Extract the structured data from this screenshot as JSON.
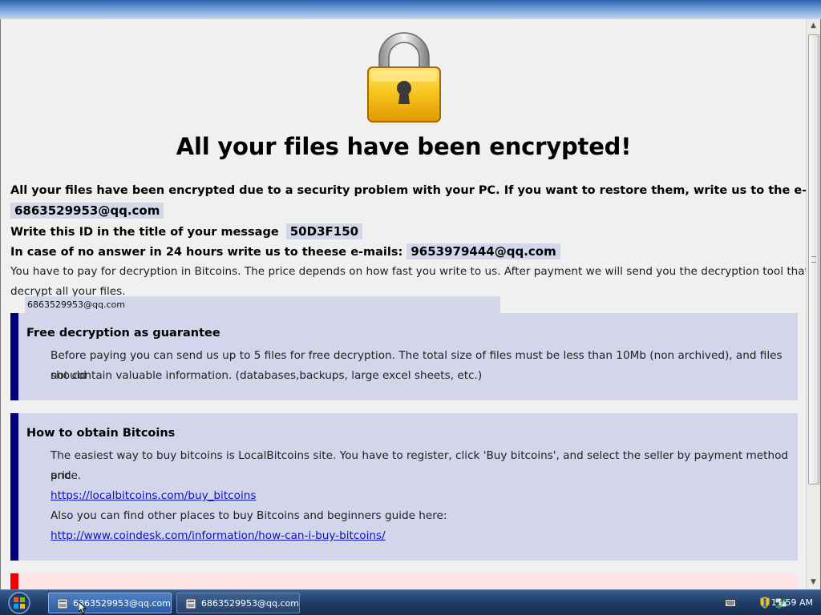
{
  "page": {
    "heading": "All your files have been encrypted!",
    "line1_text": "All your files have been encrypted due to a security problem with your PC. If you want to restore them, write us to the e-mail",
    "email1": "6863529953@qq.com",
    "line2_text": "Write this ID in the title of your message",
    "id": "50D3F150",
    "line3_text": "In case of no answer in 24 hours write us to theese e-mails:",
    "email2": "9653979444@qq.com",
    "payment_text_1": "You have to pay for decryption in Bitcoins. The price depends on how fast you write to us. After payment we will send you the decryption tool that will",
    "payment_text_2": "decrypt all your files.",
    "tooltip": "6863529953@qq.com"
  },
  "box_free": {
    "title": "Free decryption as guarantee",
    "text_1": "Before paying you can send us up to 5 files for free decryption. The total size of files must be less than 10Mb (non archived), and files should",
    "text_2": "not contain valuable information. (databases,backups, large excel sheets, etc.)"
  },
  "box_bitcoins": {
    "title": "How to obtain Bitcoins",
    "text_1": "The easiest way to buy bitcoins is LocalBitcoins site. You have to register, click 'Buy bitcoins', and select the seller by payment method and",
    "text_2": "price.",
    "link_1": "https://localbitcoins.com/buy_bitcoins",
    "text_3": "Also you can find other places to buy Bitcoins and beginners guide here:",
    "link_2": "http://www.coindesk.com/information/how-can-i-buy-bitcoins/"
  },
  "taskbar": {
    "tasks": [
      {
        "label": "6863529953@qq.com",
        "active": true
      },
      {
        "label": "6863529953@qq.com",
        "active": false
      }
    ],
    "clock": "11:59 AM"
  },
  "colors": {
    "box_border": "#00007f",
    "box_bg": "#d3d5ea",
    "red_border": "#f00000",
    "link": "#1010c0"
  },
  "icons": [
    "padlock-icon",
    "start-orb-icon",
    "app-icon",
    "keyboard-icon",
    "shield-icon",
    "network-icon",
    "mouse-cursor-icon"
  ]
}
